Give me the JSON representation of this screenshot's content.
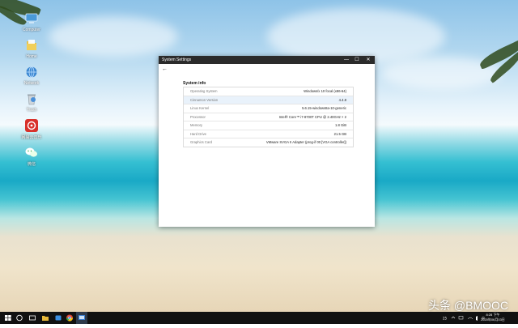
{
  "desktop": {
    "icons": [
      {
        "label": "Computer",
        "icon": "computer-icon",
        "color": "#4a9ad8"
      },
      {
        "label": "Home",
        "icon": "folder-icon",
        "color": "#e8c24a"
      },
      {
        "label": "Network",
        "icon": "network-icon",
        "color": "#3a86d1"
      },
      {
        "label": "Trash",
        "icon": "trash-icon",
        "color": "#cfd6dc"
      },
      {
        "label": "网易云音乐",
        "icon": "netease-music-icon",
        "color": "#d8312b"
      },
      {
        "label": "微信",
        "icon": "wechat-icon",
        "color": "#2aae3b"
      }
    ]
  },
  "window": {
    "title": "System Settings",
    "minimize_glyph": "—",
    "maximize_glyph": "☐",
    "close_glyph": "✕",
    "back_glyph": "←",
    "section_title": "System info",
    "rows": [
      {
        "key": "Operating System",
        "value": "Windows/x 10 focal (x86-64)"
      },
      {
        "key": "Cinnamon Version",
        "value": "4.4.8"
      },
      {
        "key": "Linux Kernel",
        "value": "5.6.15-windows8a-10-generic"
      },
      {
        "key": "Processor",
        "value": "Intel® Core™ i7-8700T CPU @ 2.40GHz × 2"
      },
      {
        "key": "Memory",
        "value": "1.8 GiB"
      },
      {
        "key": "Hard Drive",
        "value": "21.5 GB"
      },
      {
        "key": "Graphics Card",
        "value": "VMware SVGA II Adapter (prog-if 00 [VGA controller])"
      }
    ]
  },
  "watermark": "头条 @BMOOC",
  "clock": {
    "time": "8:28 下午",
    "date": "2020年06月03日"
  },
  "taskbar": {
    "accent": "#111111"
  }
}
